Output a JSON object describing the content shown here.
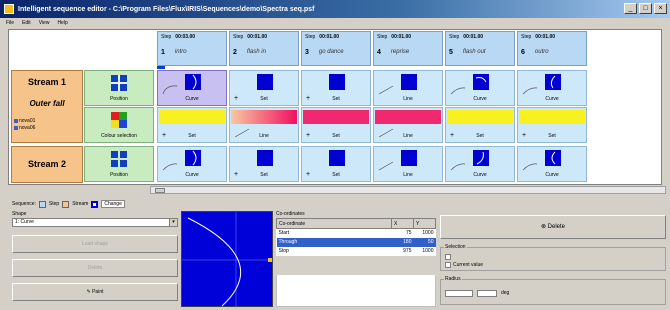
{
  "window": {
    "title": "Intelligent sequence editor - C:\\Program Files\\Flux\\IRIS\\Sequences\\demo\\Spectra seq.psf",
    "buttons": [
      "_",
      "□",
      "×"
    ]
  },
  "menu": [
    "File",
    "Edit",
    "View",
    "Help"
  ],
  "steps": [
    {
      "label": "Step",
      "time": "00:03.00",
      "num": "1",
      "name": "intro"
    },
    {
      "label": "Step",
      "time": "00:01.00",
      "num": "2",
      "name": "flash in"
    },
    {
      "label": "Step",
      "time": "00:01.00",
      "num": "3",
      "name": "go dance"
    },
    {
      "label": "Step",
      "time": "00:01.00",
      "num": "4",
      "name": "reprise"
    },
    {
      "label": "Step",
      "time": "00:01.00",
      "num": "5",
      "name": "flash out"
    },
    {
      "label": "Step",
      "time": "00:01.00",
      "num": "6",
      "name": "outro"
    }
  ],
  "streams": [
    {
      "name": "Stream 1",
      "sub": "Outer fall",
      "checks": [
        "nova01",
        "nova06"
      ]
    },
    {
      "name": "Stream 2"
    }
  ],
  "props": {
    "position": "Position",
    "colour": "Colour selection"
  },
  "cells": {
    "curve": "Curve",
    "set": "Set",
    "line": "Line",
    "plus": "+"
  },
  "colors": {
    "yellow": "#f8f020",
    "pink": "#f02870",
    "gradient_from": "#f8c8a0",
    "gradient_to": "#f01060",
    "blue": "#0000d0"
  },
  "legend": {
    "label": "Sequence:",
    "items": [
      "Step",
      "Stream",
      "Change"
    ]
  },
  "shape": {
    "label": "Shape",
    "value": "1: Curve",
    "buttons": [
      "Load shape",
      "Delete",
      "Paint"
    ]
  },
  "coords": {
    "label": "Co-ordinates",
    "headers": [
      "Co-ordinate",
      "X",
      "Y"
    ],
    "rows": [
      {
        "name": "Start",
        "x": "75",
        "y": "1000"
      },
      {
        "name": "Through",
        "x": "180",
        "y": "50"
      },
      {
        "name": "Stop",
        "x": "975",
        "y": "1000"
      }
    ]
  },
  "right": {
    "delete": "Delete",
    "selection_label": "Selection",
    "current_value": "Current value",
    "radius_label": "Radius",
    "radius_unit": "deg"
  }
}
